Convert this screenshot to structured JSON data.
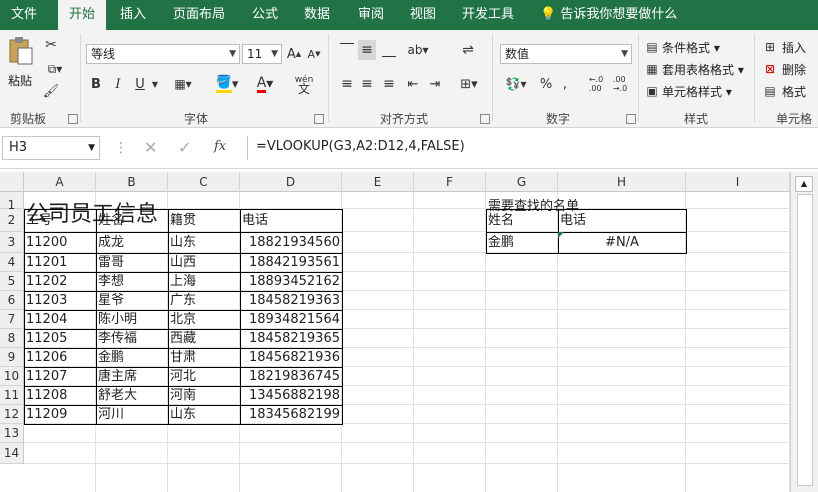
{
  "tabs": [
    "文件",
    "开始",
    "插入",
    "页面布局",
    "公式",
    "数据",
    "审阅",
    "视图",
    "开发工具"
  ],
  "active_tab": "开始",
  "tell_me": "告诉我你想要做什么",
  "ribbon": {
    "clipboard": {
      "paste_label": "粘贴",
      "group_label": "剪贴板"
    },
    "font": {
      "name": "等线",
      "size": "11",
      "group_label": "字体",
      "bold": "B",
      "italic": "I",
      "underline": "U"
    },
    "alignment": {
      "group_label": "对齐方式"
    },
    "number": {
      "format": "数值",
      "group_label": "数字"
    },
    "styles": {
      "conditional": "条件格式",
      "table": "套用表格格式",
      "cell": "单元格样式",
      "group_label": "样式"
    },
    "cells": {
      "insert": "插入",
      "delete": "删除",
      "format": "格式",
      "group_label": "单元格"
    }
  },
  "formula_bar": {
    "name_box": "H3",
    "fx": "fx",
    "formula": "=VLOOKUP(G3,A2:D12,4,FALSE)"
  },
  "sheet": {
    "columns": [
      "A",
      "B",
      "C",
      "D",
      "E",
      "F",
      "G",
      "H",
      "I"
    ],
    "rows": [
      "1",
      "2",
      "3",
      "4",
      "5",
      "6",
      "7",
      "8",
      "9",
      "10",
      "11",
      "12",
      "13",
      "14"
    ],
    "title": "公司员工信息",
    "lookup_title": "需要查找的名单",
    "table_headers": [
      "工号",
      "姓名",
      "籍贯",
      "电话"
    ],
    "table_rows": [
      [
        "11200",
        "成龙",
        "山东",
        "18821934560"
      ],
      [
        "11201",
        "雷哥",
        "山西",
        "18842193561"
      ],
      [
        "11202",
        "李想",
        "上海",
        "18893452162"
      ],
      [
        "11203",
        "星爷",
        "广东",
        "18458219363"
      ],
      [
        "11204",
        "陈小明",
        "北京",
        "18934821564"
      ],
      [
        "11205",
        "李传福",
        "西藏",
        "18458219365"
      ],
      [
        "11206",
        "金鹏",
        "甘肃",
        "18456821936"
      ],
      [
        "11207",
        "唐主席",
        "河北",
        "18219836745"
      ],
      [
        "11208",
        "舒老大",
        "河南",
        "13456882198"
      ],
      [
        "11209",
        "河川",
        "山东",
        "18345682199"
      ]
    ],
    "lookup_headers": [
      "姓名",
      "电话"
    ],
    "lookup_row": [
      "金鹏",
      "#N/A"
    ]
  },
  "colors": {
    "accent": "#217346"
  }
}
